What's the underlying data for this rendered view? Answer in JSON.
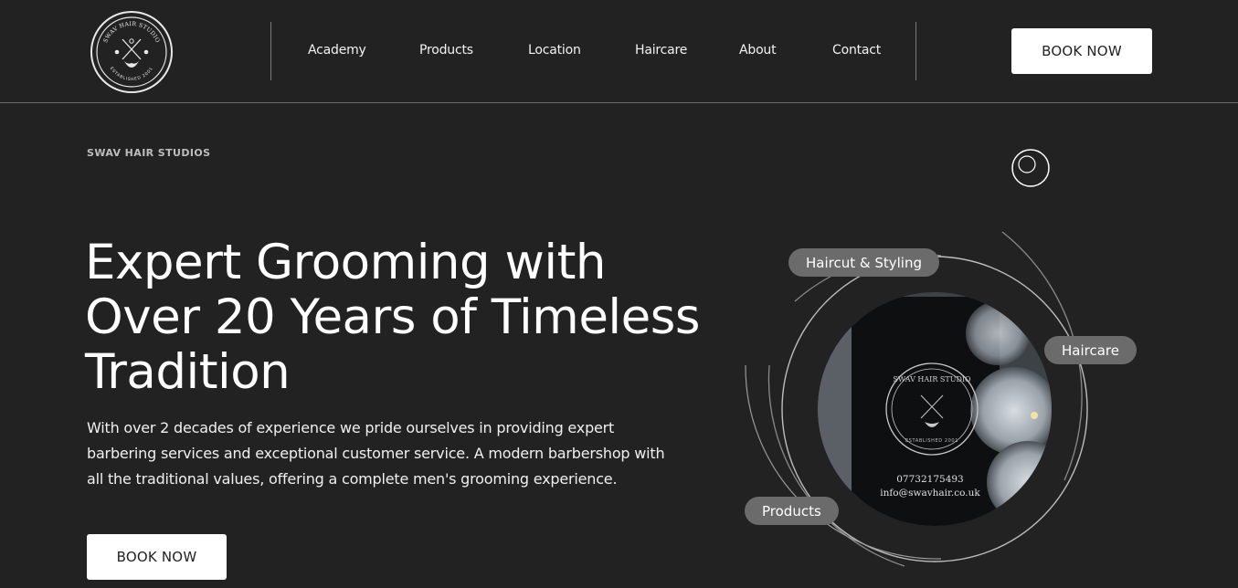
{
  "logo": {
    "top_text": "SWAV HAIR STUDIO",
    "bottom_text": "ESTABLISHED 2001"
  },
  "nav": {
    "items": [
      "Academy",
      "Products",
      "Location",
      "Haircare",
      "About",
      "Contact"
    ]
  },
  "header": {
    "book_label": "BOOK NOW"
  },
  "hero": {
    "eyebrow": "SWAV HAIR STUDIOS",
    "title": "Expert Grooming with Over 20 Years of Timeless Tradition",
    "description": "With over 2 decades of experience we pride ourselves in providing expert barbering services and exceptional customer service. A modern barbershop with all the traditional values, offering a complete men's grooming experience.",
    "book_label": "BOOK NOW"
  },
  "visual": {
    "pills": [
      "Haircut & Styling",
      "Haircare",
      "Products"
    ],
    "photo_sign": {
      "name": "SWAV HAIR STUDIO",
      "established": "ESTABLISHED 2001",
      "phone": "07732175493",
      "email": "info@swavhair.co.uk"
    }
  }
}
